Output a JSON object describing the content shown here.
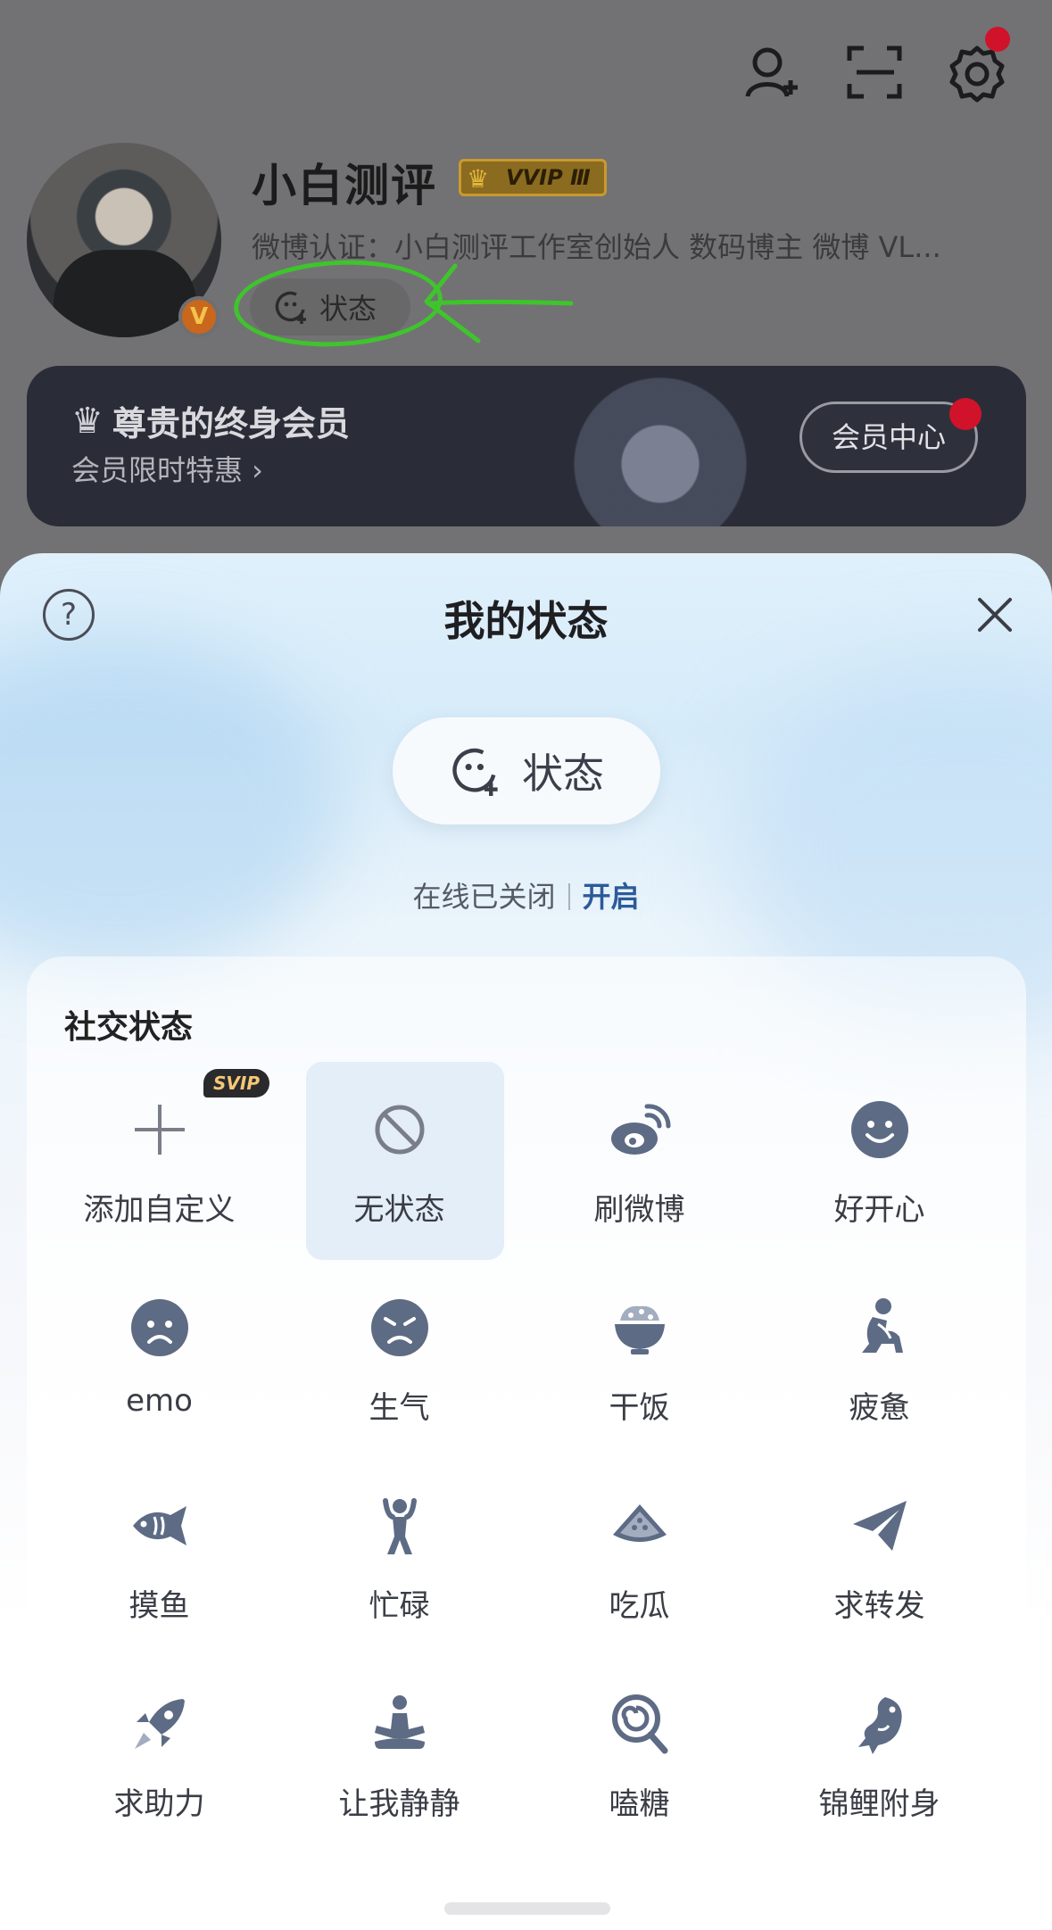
{
  "header": {
    "icons": [
      "add-friend-icon",
      "scan-icon",
      "settings-icon"
    ]
  },
  "profile": {
    "name": "小白测评",
    "vip_badge": "VVIP Ⅲ",
    "certification": "微博认证：小白测评工作室创始人 数码博主 微博 VL...",
    "status_chip": "状态"
  },
  "vip_banner": {
    "title": "尊贵的终身会员",
    "subtitle": "会员限时特惠 ›",
    "button": "会员中心"
  },
  "sheet": {
    "help": "?",
    "title": "我的状态",
    "status_button": "状态",
    "online_text": "在线已关闭",
    "online_action": "开启",
    "section_title": "社交状态",
    "svip_tag": "SVIP",
    "items": [
      {
        "label": "添加自定义",
        "icon": "plus-icon"
      },
      {
        "label": "无状态",
        "icon": "no-status-icon",
        "selected": true
      },
      {
        "label": "刷微博",
        "icon": "weibo-icon"
      },
      {
        "label": "好开心",
        "icon": "happy-face-icon"
      },
      {
        "label": "emo",
        "icon": "sad-face-icon"
      },
      {
        "label": "生气",
        "icon": "angry-face-icon"
      },
      {
        "label": "干饭",
        "icon": "rice-bowl-icon"
      },
      {
        "label": "疲惫",
        "icon": "tired-person-icon"
      },
      {
        "label": "摸鱼",
        "icon": "fish-icon"
      },
      {
        "label": "忙碌",
        "icon": "busy-person-icon"
      },
      {
        "label": "吃瓜",
        "icon": "watermelon-icon"
      },
      {
        "label": "求转发",
        "icon": "paper-plane-icon"
      },
      {
        "label": "求助力",
        "icon": "rocket-icon"
      },
      {
        "label": "让我静静",
        "icon": "meditate-icon"
      },
      {
        "label": "嗑糖",
        "icon": "lollipop-icon"
      },
      {
        "label": "锦鲤附身",
        "icon": "koi-icon"
      }
    ]
  },
  "colors": {
    "accent": "#2c5a9a",
    "icon": "#5d6b85",
    "annotation": "#3ec52b",
    "notification": "#d0132a"
  }
}
